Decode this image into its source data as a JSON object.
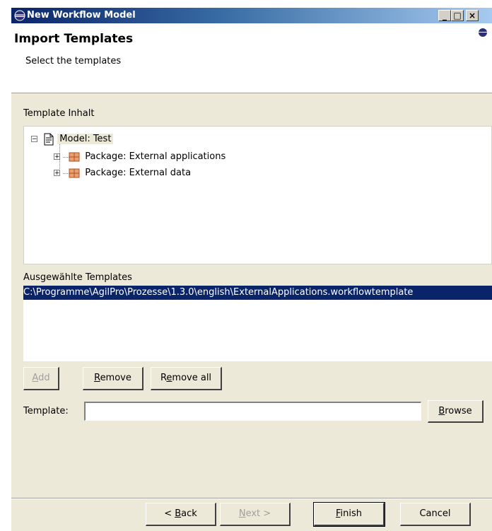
{
  "window": {
    "title": "New Workflow Model",
    "min_glyph": "_",
    "max_glyph": "□",
    "close_glyph": "×"
  },
  "header": {
    "title": "Import Templates",
    "subtitle": "Select the templates"
  },
  "content": {
    "tree_label": "Template Inhalt",
    "tree": {
      "root": {
        "label": "Model: Test",
        "expander": "−"
      },
      "children": [
        {
          "label": "Package: External applications",
          "expander": "+"
        },
        {
          "label": "Package: External data",
          "expander": "+"
        }
      ]
    },
    "selected_label": "Ausgewählte Templates",
    "selected_items": [
      "C:\\Programme\\AgilPro\\Prozesse\\1.3.0\\english\\ExternalApplications.workflowtemplate"
    ],
    "buttons": {
      "add": {
        "mnemonic": "A",
        "rest": "dd"
      },
      "remove": {
        "mnemonic": "R",
        "rest": "emove"
      },
      "remove_all": {
        "pre": "R",
        "mnemonic": "e",
        "rest": "move all"
      }
    },
    "template_field": {
      "label": "Template:",
      "value": ""
    },
    "browse": {
      "mnemonic": "B",
      "rest": "rowse"
    }
  },
  "footer": {
    "back": {
      "pre": "< ",
      "mnemonic": "B",
      "rest": "ack"
    },
    "next": {
      "mnemonic": "N",
      "rest": "ext >"
    },
    "finish": {
      "mnemonic": "F",
      "rest": "inish"
    },
    "cancel": "Cancel"
  },
  "colors": {
    "titlebar": "#0a246a",
    "selection": "#0a246a",
    "dialog_bg": "#ece9d8"
  }
}
